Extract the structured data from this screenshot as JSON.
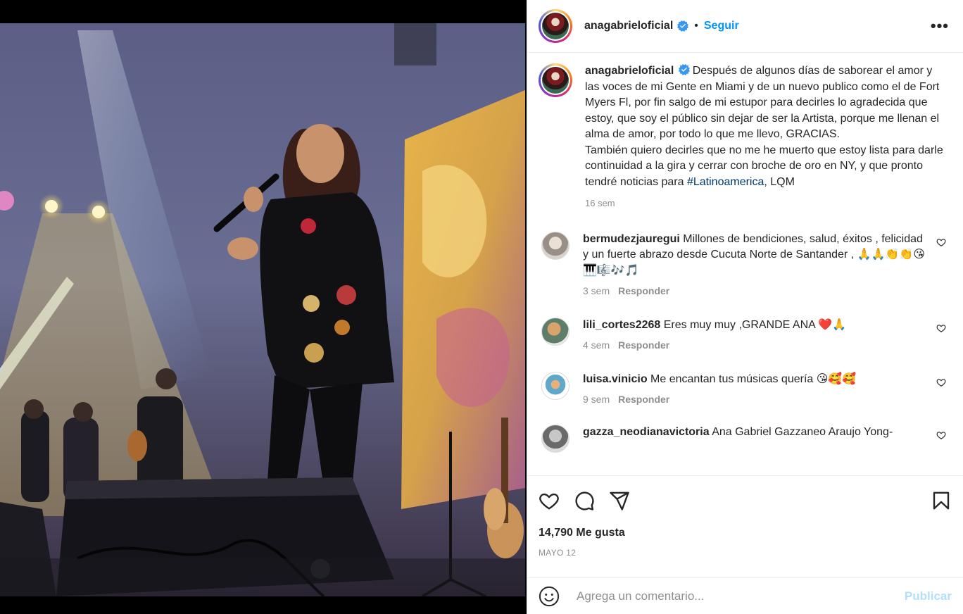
{
  "post": {
    "username": "anagabrieloficial",
    "follow_label": "Seguir",
    "more_label": "•••",
    "separator": "•"
  },
  "caption": {
    "username": "anagabrieloficial",
    "text_part1": "Después de algunos días de saborear el amor y las voces de mi Gente en Miami y de un nuevo publico como el de Fort Myers Fl, por fin salgo de mi estupor para decirles lo agradecida que estoy, que soy el público sin dejar de ser la Artista, porque me llenan el alma de amor, por todo lo que me llevo, GRACIAS.",
    "text_part2": "También quiero decirles que no me he muerto que estoy lista para darle continuidad a la gira y cerrar con broche de oro en NY, y que pronto tendré noticias para",
    "hashtag": "#Latinoamerica",
    "text_part3": ", LQM",
    "time": "16 sem"
  },
  "comments": [
    {
      "username": "bermudezjauregui",
      "text": "Millones de bendiciones, salud, éxitos , felicidad y un fuerte abrazo desde Cucuta Norte de Santander , 🙏🙏👏👏😘🎹🎼🎶🎵",
      "time": "3 sem",
      "reply": "Responder"
    },
    {
      "username": "lili_cortes2268",
      "text": "Eres muy muy ,GRANDE ANA ❤️🙏",
      "time": "4 sem",
      "reply": "Responder"
    },
    {
      "username": "luisa.vinicio",
      "text": "Me encantan tus músicas quería 😘🥰🥰",
      "time": "9 sem",
      "reply": "Responder"
    },
    {
      "username": "gazza_neodianavictoria",
      "text": "Ana Gabriel Gazzaneo Araujo Yong-",
      "time": "",
      "reply": ""
    }
  ],
  "stats": {
    "likes": "14,790 Me gusta",
    "date": "MAYO 12"
  },
  "compose": {
    "placeholder": "Agrega un comentario...",
    "publish_label": "Publicar"
  },
  "icons": {
    "like": "heart-icon",
    "comment": "comment-icon",
    "share": "share-icon",
    "save": "bookmark-icon",
    "emoji": "emoji-icon",
    "verified": "verified-badge-icon"
  },
  "colors": {
    "accent": "#0095f6",
    "publish_disabled": "#b2dffc",
    "muted": "#8e8e8e",
    "hashtag": "#00376b"
  }
}
